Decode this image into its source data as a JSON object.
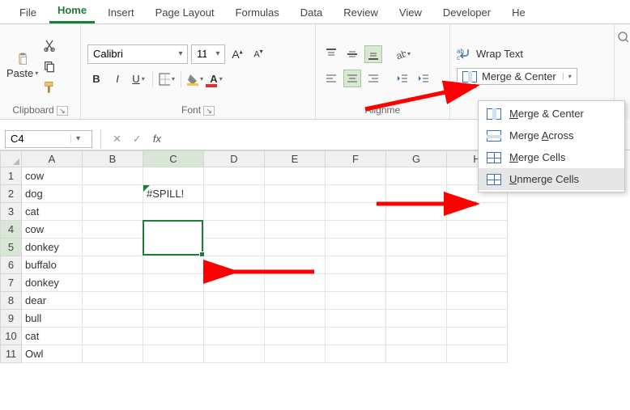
{
  "tabs": {
    "file": "File",
    "home": "Home",
    "insert": "Insert",
    "pagelayout": "Page Layout",
    "formulas": "Formulas",
    "data": "Data",
    "review": "Review",
    "view": "View",
    "developer": "Developer",
    "help": "He"
  },
  "ribbon": {
    "clipboard": {
      "paste": "Paste",
      "label": "Clipboard"
    },
    "font": {
      "name": "Calibri",
      "size": "11",
      "label": "Font",
      "bold": "B",
      "italic": "I",
      "underline": "U"
    },
    "align": {
      "label": "Alignme"
    },
    "merge": {
      "wrap": "Wrap Text",
      "button": "Merge & Center"
    }
  },
  "dropdown": {
    "merge_center": {
      "pre": "",
      "u": "M",
      "post": "erge & Center"
    },
    "merge_across": {
      "pre": "Merge ",
      "u": "A",
      "post": "cross"
    },
    "merge_cells": {
      "pre": "",
      "u": "M",
      "post": "erge Cells"
    },
    "unmerge": {
      "pre": "",
      "u": "U",
      "post": "nmerge Cells"
    }
  },
  "formulaBar": {
    "nameBox": "C4",
    "formula": ""
  },
  "columns": [
    "A",
    "B",
    "C",
    "D",
    "E",
    "F",
    "G",
    "H"
  ],
  "rows": [
    "1",
    "2",
    "3",
    "4",
    "5",
    "6",
    "7",
    "8",
    "9",
    "10",
    "11"
  ],
  "cellData": {
    "A1": "cow",
    "A2": "dog",
    "A3": "cat",
    "A4": "cow",
    "A5": "donkey",
    "A6": "buffalo",
    "A7": "donkey",
    "A8": "dear",
    "A9": "bull",
    "A10": "cat",
    "A11": "Owl",
    "C2": "#SPILL!"
  },
  "selection": {
    "ref": "C4:C5",
    "activeCell": "C4"
  },
  "colors": {
    "accent": "#1a7f37",
    "arrow": "#ff0000"
  }
}
